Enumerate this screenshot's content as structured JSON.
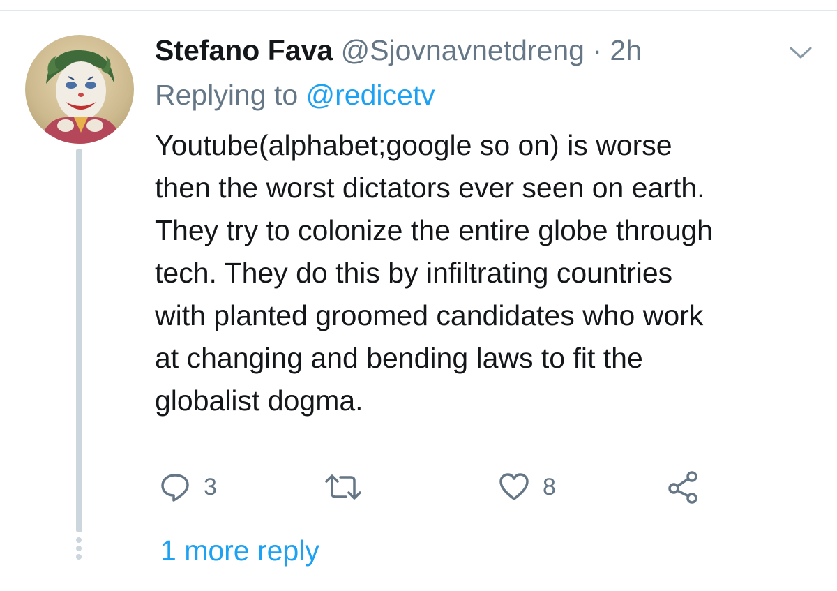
{
  "tweet": {
    "display_name": "Stefano Fava",
    "handle": "@Sjovnavnetdreng",
    "separator": "·",
    "time": "2h",
    "reply_prefix": "Replying to",
    "reply_mention": "@redicetv",
    "text": "Youtube(alphabet;google so on) is worse\nthen the worst dictators ever seen on earth.\nThey try to colonize the entire globe through\ntech. They do this by infiltrating countries\nwith planted groomed candidates who work\nat changing and bending laws to fit the\nglobalist dogma.",
    "avatar_icon": "joker-avatar",
    "menu_icon": "chevron-down-icon"
  },
  "actions": {
    "reply": {
      "icon": "reply-icon",
      "count": "3"
    },
    "retweet": {
      "icon": "retweet-icon",
      "count": ""
    },
    "like": {
      "icon": "heart-icon",
      "count": "8"
    },
    "share": {
      "icon": "share-icon",
      "count": ""
    }
  },
  "thread": {
    "more_replies_label": "1 more reply"
  },
  "colors": {
    "text_primary": "#14171a",
    "text_secondary": "#657786",
    "accent": "#1da1f2",
    "thread_line": "#ccd6dd"
  }
}
